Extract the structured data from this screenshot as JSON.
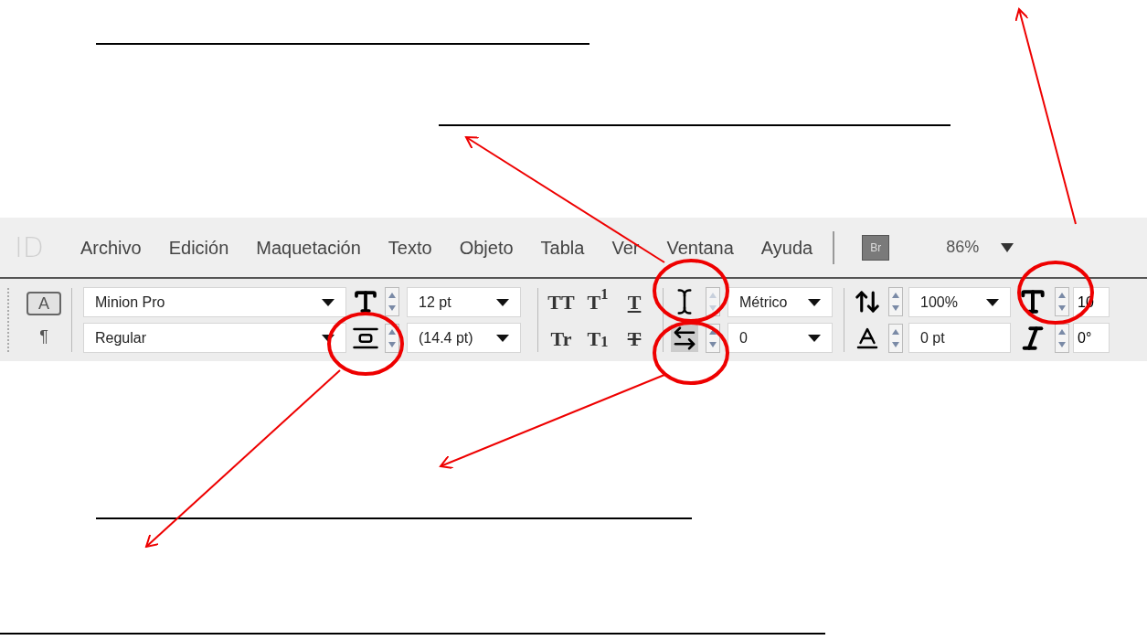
{
  "menu_bar": {
    "logo": "ID",
    "items": [
      "Archivo",
      "Edición",
      "Maquetación",
      "Texto",
      "Objeto",
      "Tabla",
      "Ver",
      "Ventana",
      "Ayuda"
    ],
    "bridge_button": "Br",
    "zoom": "86%"
  },
  "control_panel": {
    "mode_buttons": [
      {
        "label": "A",
        "selected": true
      },
      {
        "label": "¶",
        "selected": false
      }
    ],
    "font_family": "Minion Pro",
    "font_style": "Regular",
    "font_size": "12 pt",
    "leading": "(14.4 pt)",
    "style_buttons": [
      {
        "kind": "all_caps",
        "label": "TT"
      },
      {
        "kind": "superscript",
        "label": "T$^{1}$"
      },
      {
        "kind": "underline",
        "label": "T"
      },
      {
        "kind": "small_caps",
        "label": "Tr"
      },
      {
        "kind": "subscript",
        "label": "T$_{1}$"
      },
      {
        "kind": "strikethrough",
        "label": "T"
      }
    ],
    "kerning": "Métrico",
    "tracking": "0",
    "vertical_scale": "100%",
    "baseline_shift": "0 pt",
    "horizontal_scale": "10",
    "skew": "0°"
  }
}
